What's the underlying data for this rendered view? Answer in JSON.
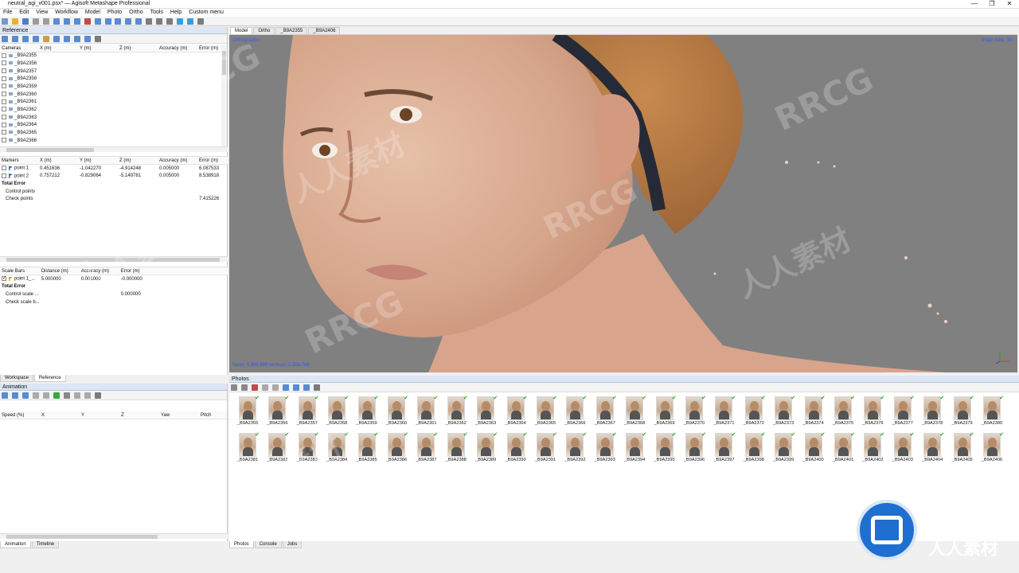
{
  "window": {
    "title": "neutral_agi_v001.psx* — Agisoft Metashape Professional",
    "controls": [
      "—",
      "❐",
      "✕"
    ]
  },
  "menu": [
    "File",
    "Edit",
    "View",
    "Workflow",
    "Model",
    "Photo",
    "Ortho",
    "Tools",
    "Help",
    "Custom menu"
  ],
  "reference_panel": {
    "title": "Reference",
    "cameras": {
      "headers": [
        "Cameras",
        "X (m)",
        "Y (m)",
        "Z (m)",
        "Accuracy (m)",
        "Error (m)"
      ],
      "rows": [
        "_B9A2355",
        "_B9A2356",
        "_B9A2357",
        "_B9A2358",
        "_B9A2359",
        "_B9A2360",
        "_B9A2361",
        "_B9A2362",
        "_B9A2363",
        "_B9A2364",
        "_B9A2365",
        "_B9A2366"
      ]
    },
    "markers": {
      "headers": [
        "Markers",
        "X (m)",
        "Y (m)",
        "Z (m)",
        "Accuracy (m)",
        "Error (m)"
      ],
      "rows": [
        {
          "name": "point 1",
          "x": "0.451636",
          "y": "-1.042270",
          "z": "-4.914248",
          "acc": "0.005000",
          "err": "6.087533"
        },
        {
          "name": "point 2",
          "x": "0.757212",
          "y": "-0.829064",
          "z": "-5.149781",
          "acc": "0.005000",
          "err": "8.538918"
        }
      ],
      "total_error": "Total Error",
      "control_points": "Control points",
      "check_points": "Check points",
      "check_points_value": "7.415226"
    },
    "scalebars": {
      "headers": [
        "Scale Bars",
        "Distance (m)",
        "Accuracy (m)",
        "Error (m)"
      ],
      "rows": [
        {
          "name": "point 1_...",
          "dist": "5.000000",
          "acc": "0.001000",
          "err": "-0.000000"
        }
      ],
      "total_error": "Total Error",
      "control_scale": "Control scale ...",
      "control_scale_value": "0.000000",
      "check_scale": "Check scale b..."
    },
    "tabs": [
      "Workspace",
      "Reference"
    ]
  },
  "animation_panel": {
    "title": "Animation",
    "headers": [
      "Speed (%)",
      "X",
      "Y",
      "Z",
      "Yaw",
      "Pitch"
    ],
    "tabs": [
      "Animation",
      "Timeline"
    ]
  },
  "viewport": {
    "tabs": [
      "Model",
      "Ortho",
      "_B9A2355",
      "_B9A2406"
    ],
    "projection_label": "Orthographic",
    "snap_label": "Snap: Axis, 3D",
    "stats_label": "faces: 4,999,999 vertices: 2,508,768"
  },
  "photos_panel": {
    "title": "Photos",
    "row1": [
      "_B9A2355",
      "_B9A2356",
      "_B9A2357",
      "_B9A2358",
      "_B9A2359",
      "_B9A2360",
      "_B9A2361",
      "_B9A2362",
      "_B9A2363",
      "_B9A2364",
      "_B9A2365",
      "_B9A2366",
      "_B9A2367",
      "_B9A2368",
      "_B9A2369",
      "_B9A2370",
      "_B9A2371",
      "_B9A2372",
      "_B9A2373",
      "_B9A2374",
      "_B9A2375",
      "_B9A2376",
      "_B9A2377",
      "_B9A2378",
      "_B9A2379",
      "_B9A2380"
    ],
    "row2": [
      "_B9A2381",
      "_B9A2382",
      "_B9A2383",
      "_B9A2384",
      "_B9A2385",
      "_B9A2386",
      "_B9A2387",
      "_B9A2388",
      "_B9A2389",
      "_B9A2390",
      "_B9A2391",
      "_B9A2392",
      "_B9A2393",
      "_B9A2394",
      "_B9A2395",
      "_B9A2396",
      "_B9A2397",
      "_B9A2398",
      "_B9A2399",
      "_B9A2400",
      "_B9A2401",
      "_B9A2402",
      "_B9A2403",
      "_B9A2404",
      "_B9A2405",
      "_B9A2406"
    ],
    "tabs": [
      "Photos",
      "Console",
      "Jobs"
    ]
  },
  "watermark": {
    "logo_text": "RRCG",
    "logo_subtext": "人人素材",
    "overlay_texts": [
      "RRCG",
      "人人素材"
    ]
  },
  "colors": {
    "viewport_bg": "#808080",
    "panel_header": "#dce6f4",
    "accent_blue": "#3355ff",
    "ok_green": "#2aa02a",
    "logo_blue": "#1e6fd0"
  }
}
